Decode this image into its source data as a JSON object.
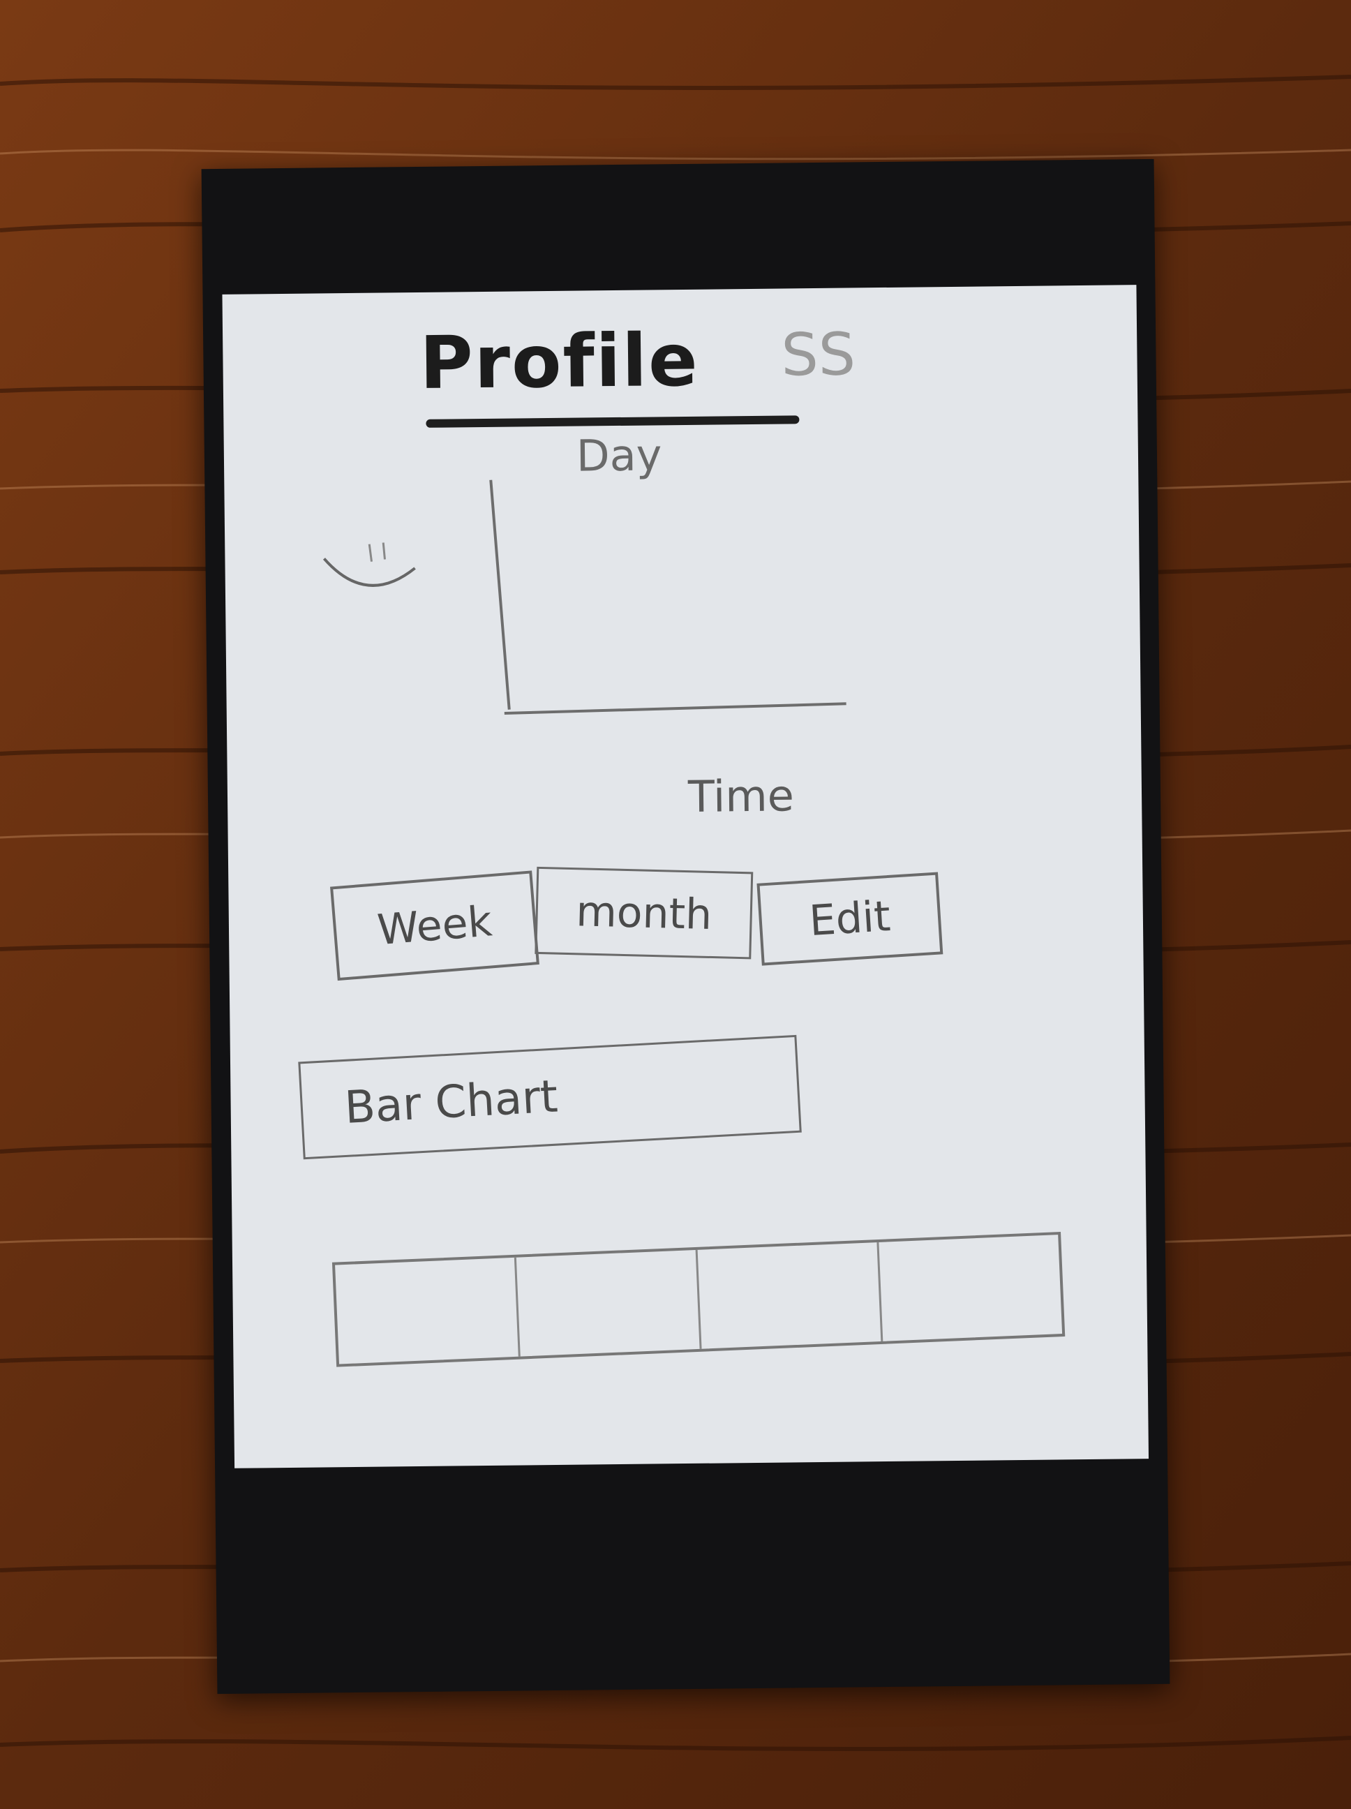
{
  "title": {
    "main": "Profile",
    "suffix": "SS"
  },
  "chart": {
    "y_label": "Day",
    "x_label": "Time"
  },
  "buttons": {
    "week": "Week",
    "month": "month",
    "edit": "Edit",
    "bar_chart": "Bar Chart"
  },
  "tabbar": {
    "tabs": [
      "",
      "",
      "",
      ""
    ]
  },
  "colors": {
    "phone_frame": "#121214",
    "screen": "#e3e6ea",
    "sketch_ink": "#555555",
    "table_wood": "#6b3112"
  }
}
